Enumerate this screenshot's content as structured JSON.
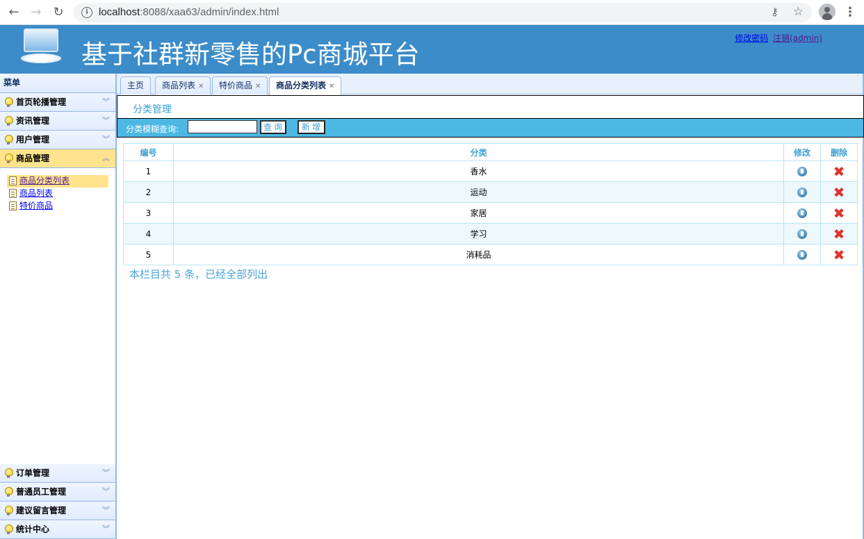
{
  "browser": {
    "url_host": "localhost",
    "url_rest": ":8088/xaa63/admin/index.html"
  },
  "header": {
    "title": "基于社群新零售的Pc商城平台",
    "change_password": "修改密码",
    "logout": "注销(admin)"
  },
  "sidebar": {
    "title": "菜单",
    "panels_top": [
      {
        "label": "首页轮播管理"
      },
      {
        "label": "资讯管理"
      },
      {
        "label": "用户管理"
      },
      {
        "label": "商品管理"
      }
    ],
    "sub_items": [
      {
        "label": "商品分类列表"
      },
      {
        "label": "商品列表"
      },
      {
        "label": "特价商品"
      }
    ],
    "panels_bottom": [
      {
        "label": "订单管理"
      },
      {
        "label": "普通员工管理"
      },
      {
        "label": "建议留言管理"
      },
      {
        "label": "统计中心"
      }
    ]
  },
  "tabs": [
    {
      "label": "主页"
    },
    {
      "label": "商品列表"
    },
    {
      "label": "特价商品"
    },
    {
      "label": "商品分类列表"
    }
  ],
  "content": {
    "title": "分类管理",
    "search_label": "分类模糊查询:",
    "search_value": "",
    "query_button": "查询",
    "add_button": "新增",
    "columns": [
      "编号",
      "分类",
      "修改",
      "删除"
    ],
    "rows": [
      {
        "id": "1",
        "name": "香水"
      },
      {
        "id": "2",
        "name": "运动"
      },
      {
        "id": "3",
        "name": "家居"
      },
      {
        "id": "4",
        "name": "学习"
      },
      {
        "id": "5",
        "name": "消耗品"
      }
    ],
    "summary": "本栏目共 5 条，已经全部列出"
  }
}
